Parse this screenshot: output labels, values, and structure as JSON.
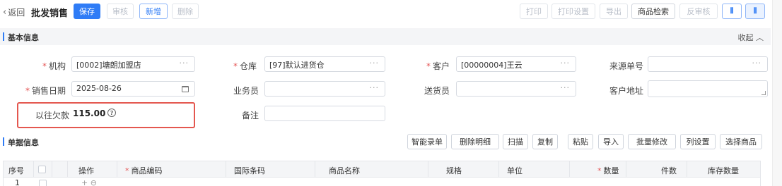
{
  "header": {
    "back_label": "返回",
    "title": "批发销售",
    "buttons": {
      "save": "保存",
      "audit": "审核",
      "add": "新增",
      "delete": "删除",
      "print": "打印",
      "print_settings": "打印设置",
      "export": "导出",
      "product_search": "商品检索",
      "unaudit": "反审核"
    }
  },
  "basic_section": {
    "title": "基本信息",
    "collapse_label": "收起"
  },
  "form": {
    "org": {
      "label": "机构",
      "value": "[0002]塘朗加盟店"
    },
    "warehouse": {
      "label": "仓库",
      "value": "[97]默认进货仓"
    },
    "customer": {
      "label": "客户",
      "value": "[00000004]王云"
    },
    "source_no": {
      "label": "来源单号",
      "value": ""
    },
    "sale_date": {
      "label": "销售日期",
      "value": "2025-08-26"
    },
    "salesperson": {
      "label": "业务员",
      "value": ""
    },
    "deliverer": {
      "label": "送货员",
      "value": ""
    },
    "address": {
      "label": "客户地址",
      "value": ""
    },
    "past_debt": {
      "label": "以往欠款",
      "value": "115.00"
    },
    "remark": {
      "label": "备注",
      "value": ""
    }
  },
  "detail_section": {
    "title": "单据信息",
    "buttons": [
      "智能录单",
      "删除明细",
      "扫描",
      "复制",
      "粘贴",
      "导入",
      "批量修改",
      "列设置",
      "选择商品"
    ]
  },
  "table": {
    "columns": [
      "序号",
      "操作",
      "商品编码",
      "国际条码",
      "商品名称",
      "规格",
      "单位",
      "数量",
      "件数",
      "库存数量"
    ],
    "rows": [
      {
        "index": "1",
        "ops": "+ ⊖"
      }
    ]
  },
  "colors": {
    "primary": "#2f7cf6",
    "required": "#e45454",
    "highlight_box": "#e4574f"
  }
}
